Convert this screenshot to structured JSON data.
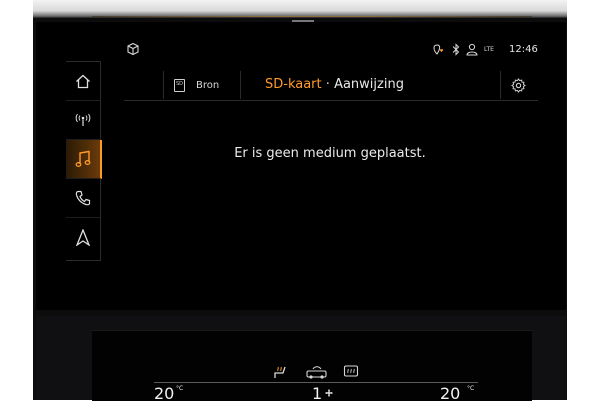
{
  "status": {
    "time": "12:46",
    "network": "LTE",
    "icons": [
      "cube-icon",
      "location-heart-icon",
      "bluetooth-icon",
      "user-icon",
      "signal-icon"
    ]
  },
  "sidebar": {
    "items": [
      {
        "name": "home",
        "icon": "home-icon",
        "active": false
      },
      {
        "name": "radio",
        "icon": "radio-icon",
        "active": false
      },
      {
        "name": "media",
        "icon": "music-note-icon",
        "active": true
      },
      {
        "name": "phone",
        "icon": "phone-icon",
        "active": false
      },
      {
        "name": "navigation",
        "icon": "navigation-arrow-icon",
        "active": false
      }
    ],
    "active_color": "#ff9a2a"
  },
  "header": {
    "source_icon_text": "SD",
    "source_label": "Bron",
    "title_accent": "SD-kaart",
    "title_separator": "·",
    "title_rest": "Aanwijzing",
    "settings_icon": "gear-icon"
  },
  "main": {
    "message": "Er is geen medium geplaatst."
  },
  "climate": {
    "left_temp": "20",
    "left_unit": "°C",
    "fan_level": "1",
    "right_temp": "20",
    "right_unit": "°C",
    "icons": [
      "seat-heat-icon",
      "recirculation-icon",
      "rear-defrost-icon"
    ]
  },
  "colors": {
    "accent": "#ff9a2a",
    "text": "#ececec",
    "background": "#000000"
  }
}
